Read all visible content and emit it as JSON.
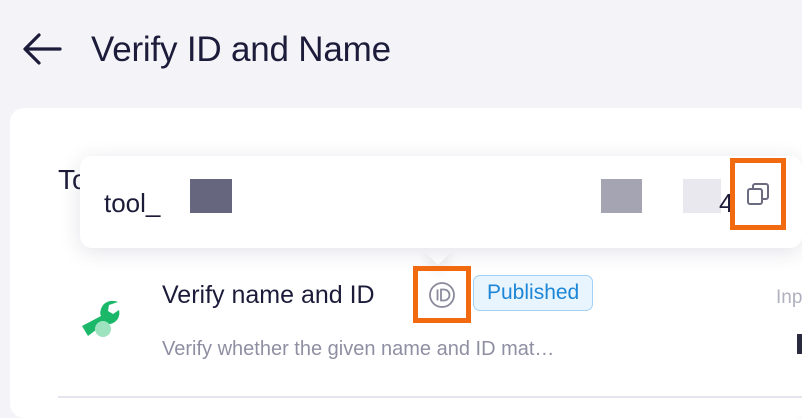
{
  "header": {
    "back_icon": "arrow-left-icon",
    "title": "Verify ID and Name"
  },
  "card": {
    "heading_partial": "To"
  },
  "tooltip": {
    "text": "tool_",
    "tail_char": "4",
    "copy_icon": "copy-icon"
  },
  "tool": {
    "icon": "wrench-icon",
    "icon_color": "#1cb86a",
    "name": "Verify name and ID",
    "id_icon": "id-icon",
    "status": "Published",
    "description": "Verify whether the given name and ID mat…",
    "right_label_partial": "Inp"
  },
  "colors": {
    "highlight": "#f26a0f",
    "badge_text": "#1d86d6"
  }
}
